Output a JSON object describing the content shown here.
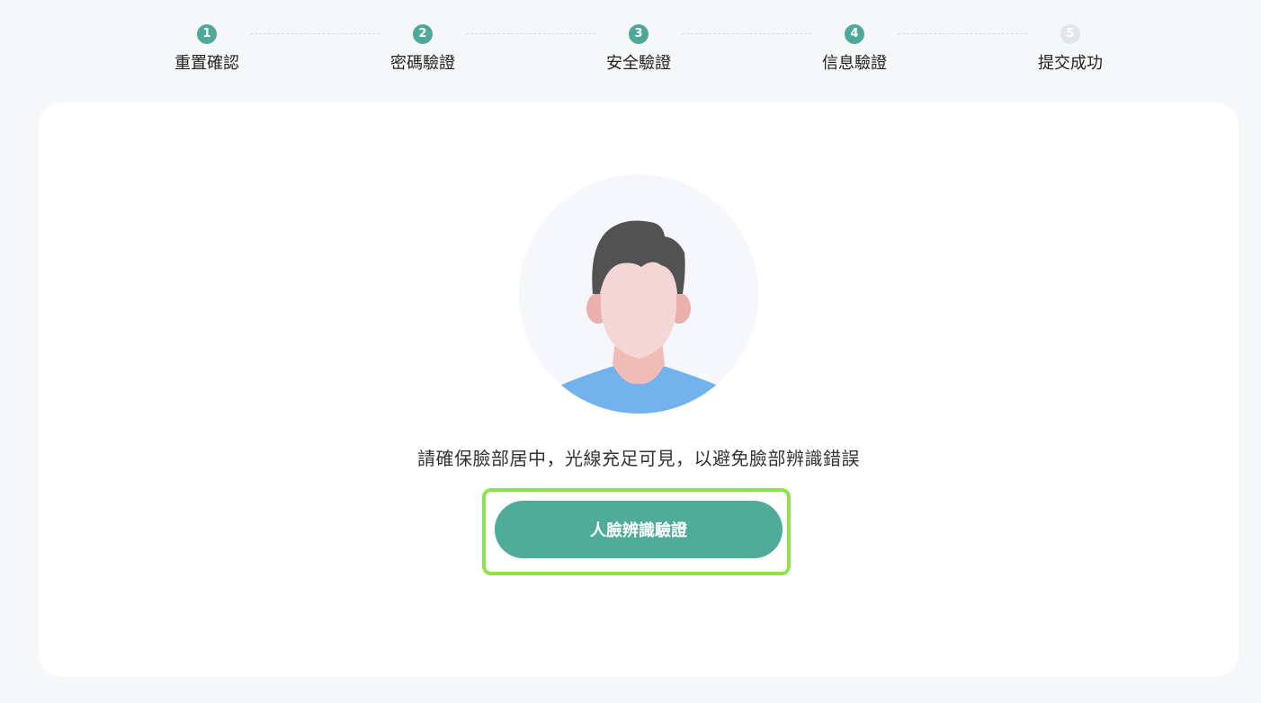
{
  "stepper": {
    "steps": [
      {
        "number": "1",
        "label": "重置確認",
        "status": "done"
      },
      {
        "number": "2",
        "label": "密碼驗證",
        "status": "done"
      },
      {
        "number": "3",
        "label": "安全驗證",
        "status": "done"
      },
      {
        "number": "4",
        "label": "信息驗證",
        "status": "done"
      },
      {
        "number": "5",
        "label": "提交成功",
        "status": "todo"
      }
    ]
  },
  "main": {
    "hint": "請確保臉部居中，光線充足可見，以避免臉部辨識錯誤",
    "face_button_label": "人臉辨識驗證",
    "avatar_icon": "person-face-icon"
  },
  "colors": {
    "accent": "#4fa99a",
    "button": "#4fac98",
    "highlight": "#8ee34b",
    "inactive_step": "#e3e5e8"
  }
}
